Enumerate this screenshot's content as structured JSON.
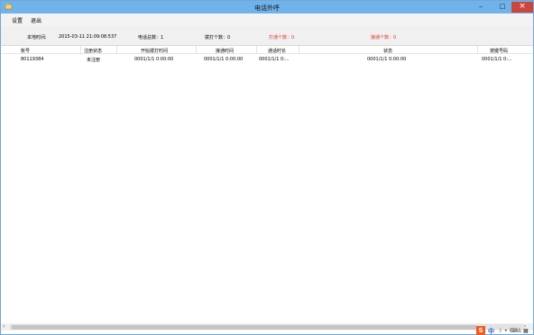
{
  "window": {
    "title": "电话外呼"
  },
  "menu": {
    "items": [
      "设置",
      "退出"
    ]
  },
  "status": {
    "time_label": "本地时间:",
    "time_value": "2015-03-11 21:09:08:537",
    "total": "电话总数：1",
    "dialed": "拨打个数：0",
    "connected": "打通个数：0",
    "answered": "接通个数：0"
  },
  "colors": {
    "titlebar": "#6fb3ea",
    "close": "#c9473f",
    "highlight": "#e4312b"
  },
  "table": {
    "columns": [
      "账号",
      "注册状态",
      "开始拨打时间",
      "接通时间",
      "通话时长",
      "状态",
      "按键号码"
    ],
    "rows": [
      [
        "80119384",
        "未注册",
        "0001/1/1 0:00:00",
        "0001/1/1 0:00:00",
        "0001/1/1 0:...",
        "0001/1/1 0:00:00",
        "0001/1/1 0:..."
      ]
    ]
  },
  "ime": {
    "logo": "S",
    "lang": "中",
    "icons": [
      "moon-icon",
      "dot-icon",
      "keyboard-icon",
      "person-icon",
      "grid-icon"
    ]
  }
}
